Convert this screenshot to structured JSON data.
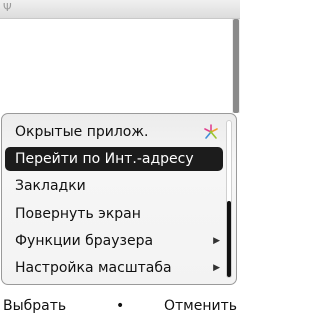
{
  "statusbar": {
    "signal_icon": "Ψ"
  },
  "menu": {
    "items": [
      {
        "label": "Окрытые прилож.",
        "selected": false,
        "has_submenu": false,
        "icon": "multitask-star-icon"
      },
      {
        "label": "Перейти по Инт.-адресу",
        "selected": true,
        "has_submenu": false
      },
      {
        "label": "Закладки",
        "selected": false,
        "has_submenu": false
      },
      {
        "label": "Повернуть экран",
        "selected": false,
        "has_submenu": false
      },
      {
        "label": "Функции браузера",
        "selected": false,
        "has_submenu": true
      },
      {
        "label": "Настройка масштаба",
        "selected": false,
        "has_submenu": true
      }
    ],
    "submenu_arrow": "▶"
  },
  "softkeys": {
    "left": "Выбрать",
    "middle": "•",
    "right": "Отменить"
  },
  "colors": {
    "selection": "#1c1c1c",
    "star_pink": "#e0418f",
    "star_green": "#9bc52e",
    "star_blue": "#3f8fd8",
    "star_orange": "#f0a030"
  }
}
